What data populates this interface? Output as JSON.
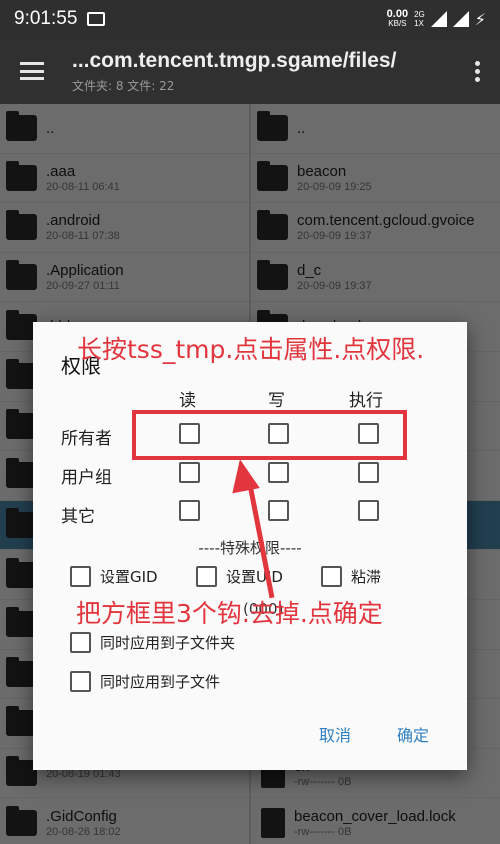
{
  "status": {
    "time": "9:01:55",
    "net_speed": "0.00",
    "net_unit": "KB/S",
    "net_type_top": "2G",
    "net_type_bottom": "1X"
  },
  "appbar": {
    "path": "...com.tencent.tmgp.sgame/files/",
    "counts": "文件夹: 8  文件: 22"
  },
  "left_list": [
    {
      "name": "..",
      "meta": "",
      "type": "folder"
    },
    {
      "name": ".aaa",
      "meta": "20-08-11 06:41",
      "type": "folder"
    },
    {
      "name": ".android",
      "meta": "20-08-11 07:38",
      "type": "folder"
    },
    {
      "name": ".Application",
      "meta": "20-09-27 01:11",
      "type": "folder"
    },
    {
      "name": ".bbb",
      "meta": "",
      "type": "folder"
    },
    {
      "name": "",
      "meta": "",
      "type": "folder"
    },
    {
      "name": "",
      "meta": "",
      "type": "folder"
    },
    {
      "name": "",
      "meta": "",
      "type": "folder"
    },
    {
      "name": "",
      "meta": "",
      "type": "folder"
    },
    {
      "name": "",
      "meta": "",
      "type": "folder"
    },
    {
      "name": "",
      "meta": "",
      "type": "folder"
    },
    {
      "name": "",
      "meta": "",
      "type": "folder"
    },
    {
      "name": "",
      "meta": "",
      "type": "folder"
    },
    {
      "name": "",
      "meta": "20-08-19 01:43",
      "type": "folder"
    },
    {
      "name": ".GidConfig",
      "meta": "20-08-26 18:02",
      "type": "folder"
    }
  ],
  "right_list": [
    {
      "name": "..",
      "meta": "",
      "type": "folder"
    },
    {
      "name": "beacon",
      "meta": "20-09-09 19:25",
      "type": "folder"
    },
    {
      "name": "com.tencent.gcloud.gvoice",
      "meta": "20-09-09 19:37",
      "type": "folder"
    },
    {
      "name": "d_c",
      "meta": "20-09-09 19:37",
      "type": "folder"
    },
    {
      "name": "download",
      "meta": "",
      "type": "folder"
    },
    {
      "name": "",
      "meta": "",
      "type": "folder"
    },
    {
      "name": "",
      "meta": "",
      "type": "folder"
    },
    {
      "name": "",
      "meta": "",
      "type": "folder"
    },
    {
      "name": "",
      "meta": "",
      "type": "folder"
    },
    {
      "name": "",
      "meta": "",
      "type": "folder"
    },
    {
      "name": "",
      "meta": "",
      "type": "file"
    },
    {
      "name": "",
      "meta": "",
      "type": "file"
    },
    {
      "name": "",
      "meta": "",
      "type": "file"
    },
    {
      "name": "ck",
      "meta": "-rw------- 0B",
      "type": "file"
    },
    {
      "name": "beacon_cover_load.lock",
      "meta": "-rw------- 0B",
      "type": "file"
    }
  ],
  "dialog": {
    "title": "权限",
    "col_read": "读",
    "col_write": "写",
    "col_exec": "执行",
    "row_owner": "所有者",
    "row_group": "用户组",
    "row_other": "其它",
    "special_title": "----特殊权限----",
    "opt_gid": "设置GID",
    "opt_uid": "设置UID",
    "opt_sticky": "粘滞",
    "number": "(000)",
    "opt_apply_folders": "同时应用到子文件夹",
    "opt_apply_files": "同时应用到子文件",
    "cancel": "取消",
    "ok": "确定"
  },
  "annotations": {
    "top": "长按tss_tmp.点击属性.点权限.",
    "bottom": "把方框里3个钩.去掉.点确定"
  },
  "colors": {
    "accent": "#2f7fc1",
    "annotation": "#e2363f",
    "selected": "#4c8cb2"
  }
}
